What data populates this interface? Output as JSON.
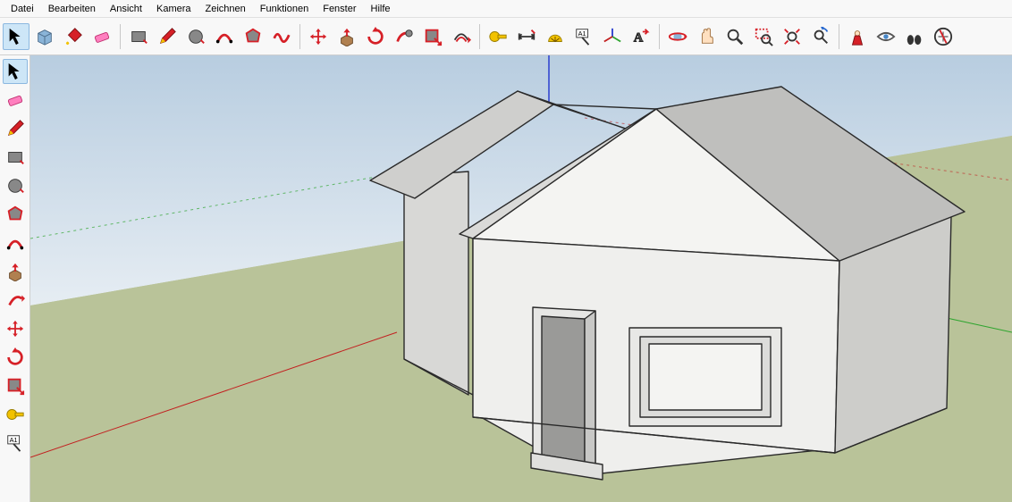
{
  "menu": {
    "items": [
      "Datei",
      "Bearbeiten",
      "Ansicht",
      "Kamera",
      "Zeichnen",
      "Funktionen",
      "Fenster",
      "Hilfe"
    ]
  },
  "htoolbar": [
    {
      "name": "select-tool",
      "icon": "arrow",
      "selected": true
    },
    {
      "name": "make-component-tool",
      "icon": "box3d"
    },
    {
      "name": "paint-bucket-tool",
      "icon": "bucket"
    },
    {
      "name": "eraser-tool",
      "icon": "eraser"
    },
    {
      "sep": true
    },
    {
      "name": "rectangle-tool",
      "icon": "rect"
    },
    {
      "name": "line-tool",
      "icon": "pencil"
    },
    {
      "name": "circle-tool",
      "icon": "circle"
    },
    {
      "name": "arc-tool",
      "icon": "arc"
    },
    {
      "name": "polygon-tool",
      "icon": "polygon"
    },
    {
      "name": "freehand-tool",
      "icon": "freehand"
    },
    {
      "sep": true
    },
    {
      "name": "move-tool",
      "icon": "move"
    },
    {
      "name": "push-pull-tool",
      "icon": "pushpull"
    },
    {
      "name": "rotate-tool",
      "icon": "rotate"
    },
    {
      "name": "follow-me-tool",
      "icon": "followme"
    },
    {
      "name": "scale-tool",
      "icon": "scale"
    },
    {
      "name": "offset-tool",
      "icon": "offset"
    },
    {
      "sep": true
    },
    {
      "name": "tape-measure-tool",
      "icon": "tape"
    },
    {
      "name": "dimension-tool",
      "icon": "dimtool"
    },
    {
      "name": "protractor-tool",
      "icon": "protractor"
    },
    {
      "name": "text-tool",
      "icon": "textlabel"
    },
    {
      "name": "axes-tool",
      "icon": "axes"
    },
    {
      "name": "3d-text-tool",
      "icon": "text3d"
    },
    {
      "sep": true
    },
    {
      "name": "orbit-tool",
      "icon": "orbit"
    },
    {
      "name": "pan-tool",
      "icon": "hand"
    },
    {
      "name": "zoom-tool",
      "icon": "zoom"
    },
    {
      "name": "zoom-window-tool",
      "icon": "zoomwin"
    },
    {
      "name": "zoom-extents-tool",
      "icon": "zoomext"
    },
    {
      "name": "previous-view-tool",
      "icon": "zoomprev"
    },
    {
      "sep": true
    },
    {
      "name": "position-camera-tool",
      "icon": "camera"
    },
    {
      "name": "look-around-tool",
      "icon": "eye"
    },
    {
      "name": "walk-tool",
      "icon": "walk"
    },
    {
      "name": "section-plane-tool",
      "icon": "section"
    }
  ],
  "vtoolbar": [
    {
      "name": "select-tool",
      "icon": "arrow",
      "selected": true
    },
    {
      "name": "eraser-tool",
      "icon": "eraser"
    },
    {
      "name": "line-tool",
      "icon": "pencil"
    },
    {
      "name": "rectangle-tool",
      "icon": "rect"
    },
    {
      "name": "circle-tool",
      "icon": "circle"
    },
    {
      "name": "polygon-tool",
      "icon": "polygon"
    },
    {
      "name": "arc-tool",
      "icon": "arc"
    },
    {
      "name": "push-pull-tool",
      "icon": "pushpull"
    },
    {
      "name": "follow-me-tool",
      "icon": "followme2"
    },
    {
      "name": "move-tool",
      "icon": "move"
    },
    {
      "name": "rotate-tool",
      "icon": "rotate"
    },
    {
      "name": "scale-tool",
      "icon": "scale"
    },
    {
      "name": "tape-measure-tool",
      "icon": "tape"
    },
    {
      "name": "text-tool",
      "icon": "textlabel"
    }
  ],
  "colors": {
    "tool_red": "#d62027",
    "tool_yellow": "#f2c200",
    "tool_grey": "#6a6a6a",
    "axis_blue": "#2a3ecf",
    "axis_green": "#2fa52f",
    "axis_red": "#c22020"
  }
}
